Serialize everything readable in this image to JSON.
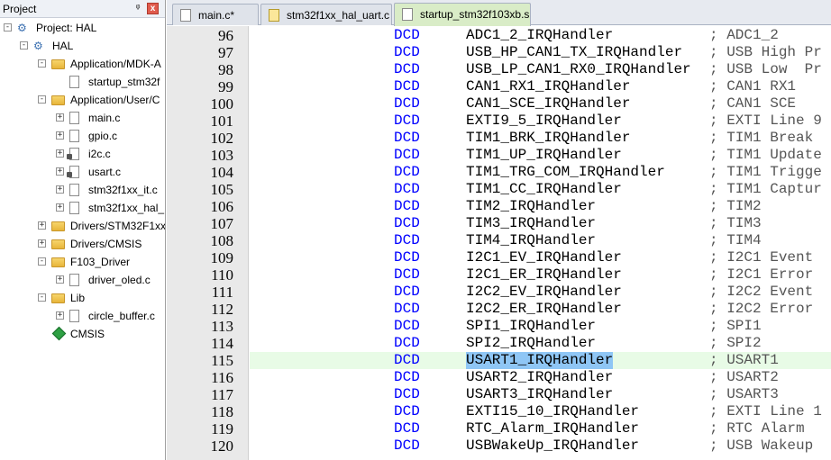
{
  "project_panel": {
    "title": "Project",
    "pin": "ᵠ",
    "close": "x",
    "tree": [
      {
        "label": "Project: HAL",
        "level": 0,
        "expander": "−",
        "icon": "project-icon"
      },
      {
        "label": "HAL",
        "level": 1,
        "expander": "−",
        "icon": "target-icon"
      },
      {
        "label": "Application/MDK-A",
        "level": 2,
        "expander": "−",
        "icon": "folder-icon"
      },
      {
        "label": "startup_stm32f",
        "level": 3,
        "expander": "",
        "icon": "file-icon"
      },
      {
        "label": "Application/User/C",
        "level": 2,
        "expander": "−",
        "icon": "folder-icon"
      },
      {
        "label": "main.c",
        "level": 3,
        "expander": "+",
        "icon": "file-icon"
      },
      {
        "label": "gpio.c",
        "level": 3,
        "expander": "+",
        "icon": "file-icon"
      },
      {
        "label": "i2c.c",
        "level": 3,
        "expander": "+",
        "icon": "file-options-icon"
      },
      {
        "label": "usart.c",
        "level": 3,
        "expander": "+",
        "icon": "file-options-icon"
      },
      {
        "label": "stm32f1xx_it.c",
        "level": 3,
        "expander": "+",
        "icon": "file-icon"
      },
      {
        "label": "stm32f1xx_hal_",
        "level": 3,
        "expander": "+",
        "icon": "file-icon"
      },
      {
        "label": "Drivers/STM32F1xx",
        "level": 2,
        "expander": "+",
        "icon": "folder-icon"
      },
      {
        "label": "Drivers/CMSIS",
        "level": 2,
        "expander": "+",
        "icon": "folder-icon"
      },
      {
        "label": "F103_Driver",
        "level": 2,
        "expander": "−",
        "icon": "folder-icon"
      },
      {
        "label": "driver_oled.c",
        "level": 3,
        "expander": "+",
        "icon": "file-icon"
      },
      {
        "label": "Lib",
        "level": 2,
        "expander": "−",
        "icon": "folder-icon"
      },
      {
        "label": "circle_buffer.c",
        "level": 3,
        "expander": "+",
        "icon": "file-icon"
      },
      {
        "label": "CMSIS",
        "level": 2,
        "expander": "",
        "icon": "cmsis-diamond-icon"
      }
    ]
  },
  "tabs": [
    {
      "label": "main.c*",
      "active": false,
      "icon": "file-icon"
    },
    {
      "label": "stm32f1xx_hal_uart.c",
      "active": false,
      "icon": "file-options-icon"
    },
    {
      "label": "startup_stm32f103xb.s",
      "active": true,
      "icon": "file-icon"
    }
  ],
  "editor": {
    "colors": {
      "keyword": "#0000ff",
      "current_line": "#e8fbe6",
      "selection": "#8fc6f5"
    },
    "lines": [
      {
        "num": "96",
        "kw": "DCD",
        "handler": "ADC1_2_IRQHandler",
        "comment": "; ADC1_2"
      },
      {
        "num": "97",
        "kw": "DCD",
        "handler": "USB_HP_CAN1_TX_IRQHandler",
        "comment": "; USB High Pr"
      },
      {
        "num": "98",
        "kw": "DCD",
        "handler": "USB_LP_CAN1_RX0_IRQHandler",
        "comment": "; USB Low  Pr"
      },
      {
        "num": "99",
        "kw": "DCD",
        "handler": "CAN1_RX1_IRQHandler",
        "comment": "; CAN1 RX1"
      },
      {
        "num": "100",
        "kw": "DCD",
        "handler": "CAN1_SCE_IRQHandler",
        "comment": "; CAN1 SCE"
      },
      {
        "num": "101",
        "kw": "DCD",
        "handler": "EXTI9_5_IRQHandler",
        "comment": "; EXTI Line 9"
      },
      {
        "num": "102",
        "kw": "DCD",
        "handler": "TIM1_BRK_IRQHandler",
        "comment": "; TIM1 Break"
      },
      {
        "num": "103",
        "kw": "DCD",
        "handler": "TIM1_UP_IRQHandler",
        "comment": "; TIM1 Update"
      },
      {
        "num": "104",
        "kw": "DCD",
        "handler": "TIM1_TRG_COM_IRQHandler",
        "comment": "; TIM1 Trigge"
      },
      {
        "num": "105",
        "kw": "DCD",
        "handler": "TIM1_CC_IRQHandler",
        "comment": "; TIM1 Captur"
      },
      {
        "num": "106",
        "kw": "DCD",
        "handler": "TIM2_IRQHandler",
        "comment": "; TIM2"
      },
      {
        "num": "107",
        "kw": "DCD",
        "handler": "TIM3_IRQHandler",
        "comment": "; TIM3"
      },
      {
        "num": "108",
        "kw": "DCD",
        "handler": "TIM4_IRQHandler",
        "comment": "; TIM4"
      },
      {
        "num": "109",
        "kw": "DCD",
        "handler": "I2C1_EV_IRQHandler",
        "comment": "; I2C1 Event"
      },
      {
        "num": "110",
        "kw": "DCD",
        "handler": "I2C1_ER_IRQHandler",
        "comment": "; I2C1 Error"
      },
      {
        "num": "111",
        "kw": "DCD",
        "handler": "I2C2_EV_IRQHandler",
        "comment": "; I2C2 Event"
      },
      {
        "num": "112",
        "kw": "DCD",
        "handler": "I2C2_ER_IRQHandler",
        "comment": "; I2C2 Error"
      },
      {
        "num": "113",
        "kw": "DCD",
        "handler": "SPI1_IRQHandler",
        "comment": "; SPI1"
      },
      {
        "num": "114",
        "kw": "DCD",
        "handler": "SPI2_IRQHandler",
        "comment": "; SPI2"
      },
      {
        "num": "115",
        "kw": "DCD",
        "handler": "USART1_IRQHandler",
        "comment": "; USART1",
        "current": true,
        "selected": true
      },
      {
        "num": "116",
        "kw": "DCD",
        "handler": "USART2_IRQHandler",
        "comment": "; USART2"
      },
      {
        "num": "117",
        "kw": "DCD",
        "handler": "USART3_IRQHandler",
        "comment": "; USART3"
      },
      {
        "num": "118",
        "kw": "DCD",
        "handler": "EXTI15_10_IRQHandler",
        "comment": "; EXTI Line 1"
      },
      {
        "num": "119",
        "kw": "DCD",
        "handler": "RTC_Alarm_IRQHandler",
        "comment": "; RTC Alarm"
      },
      {
        "num": "120",
        "kw": "DCD",
        "handler": "USBWakeUp_IRQHandler",
        "comment": "; USB Wakeup"
      }
    ]
  }
}
